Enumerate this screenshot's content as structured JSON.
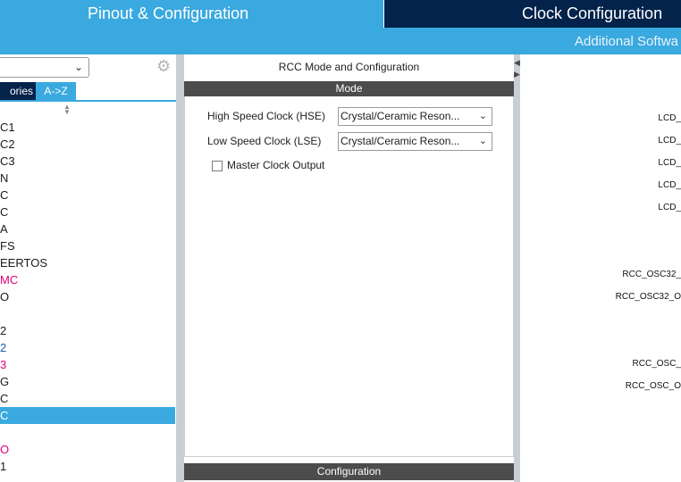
{
  "tabs": {
    "pinout": "Pinout & Configuration",
    "clock": "Clock Configuration"
  },
  "subbar": {
    "label": "Additional Softwa"
  },
  "left": {
    "tab_categories": "ories",
    "tab_az": "A->Z",
    "items": [
      {
        "label": "C1",
        "style": ""
      },
      {
        "label": "C2",
        "style": ""
      },
      {
        "label": "C3",
        "style": ""
      },
      {
        "label": "N",
        "style": ""
      },
      {
        "label": "C",
        "style": ""
      },
      {
        "label": "C",
        "style": ""
      },
      {
        "label": "A",
        "style": ""
      },
      {
        "label": "FS",
        "style": ""
      },
      {
        "label": "EERTOS",
        "style": ""
      },
      {
        "label": "MC",
        "style": "pink"
      },
      {
        "label": "O",
        "style": ""
      },
      {
        "label": "",
        "style": ""
      },
      {
        "label": "2",
        "style": ""
      },
      {
        "label": "2",
        "style": "blue"
      },
      {
        "label": "3",
        "style": "pink"
      },
      {
        "label": "G",
        "style": ""
      },
      {
        "label": "C",
        "style": ""
      },
      {
        "label": "C",
        "style": "sel"
      },
      {
        "label": "",
        "style": ""
      },
      {
        "label": "O",
        "style": "pink"
      },
      {
        "label": "1",
        "style": ""
      }
    ]
  },
  "center": {
    "title": "RCC Mode and Configuration",
    "mode_header": "Mode",
    "hse_label": "High Speed Clock (HSE)",
    "hse_value": "Crystal/Ceramic Reson...",
    "lse_label": "Low Speed Clock (LSE)",
    "lse_value": "Crystal/Ceramic Reson...",
    "mco_label": "Master Clock Output",
    "config_header": "Configuration"
  },
  "right": {
    "pins": [
      "LCD_",
      "LCD_",
      "LCD_",
      "LCD_",
      "LCD_",
      "RCC_OSC32_",
      "RCC_OSC32_O",
      "RCC_OSC_",
      "RCC_OSC_O"
    ]
  }
}
